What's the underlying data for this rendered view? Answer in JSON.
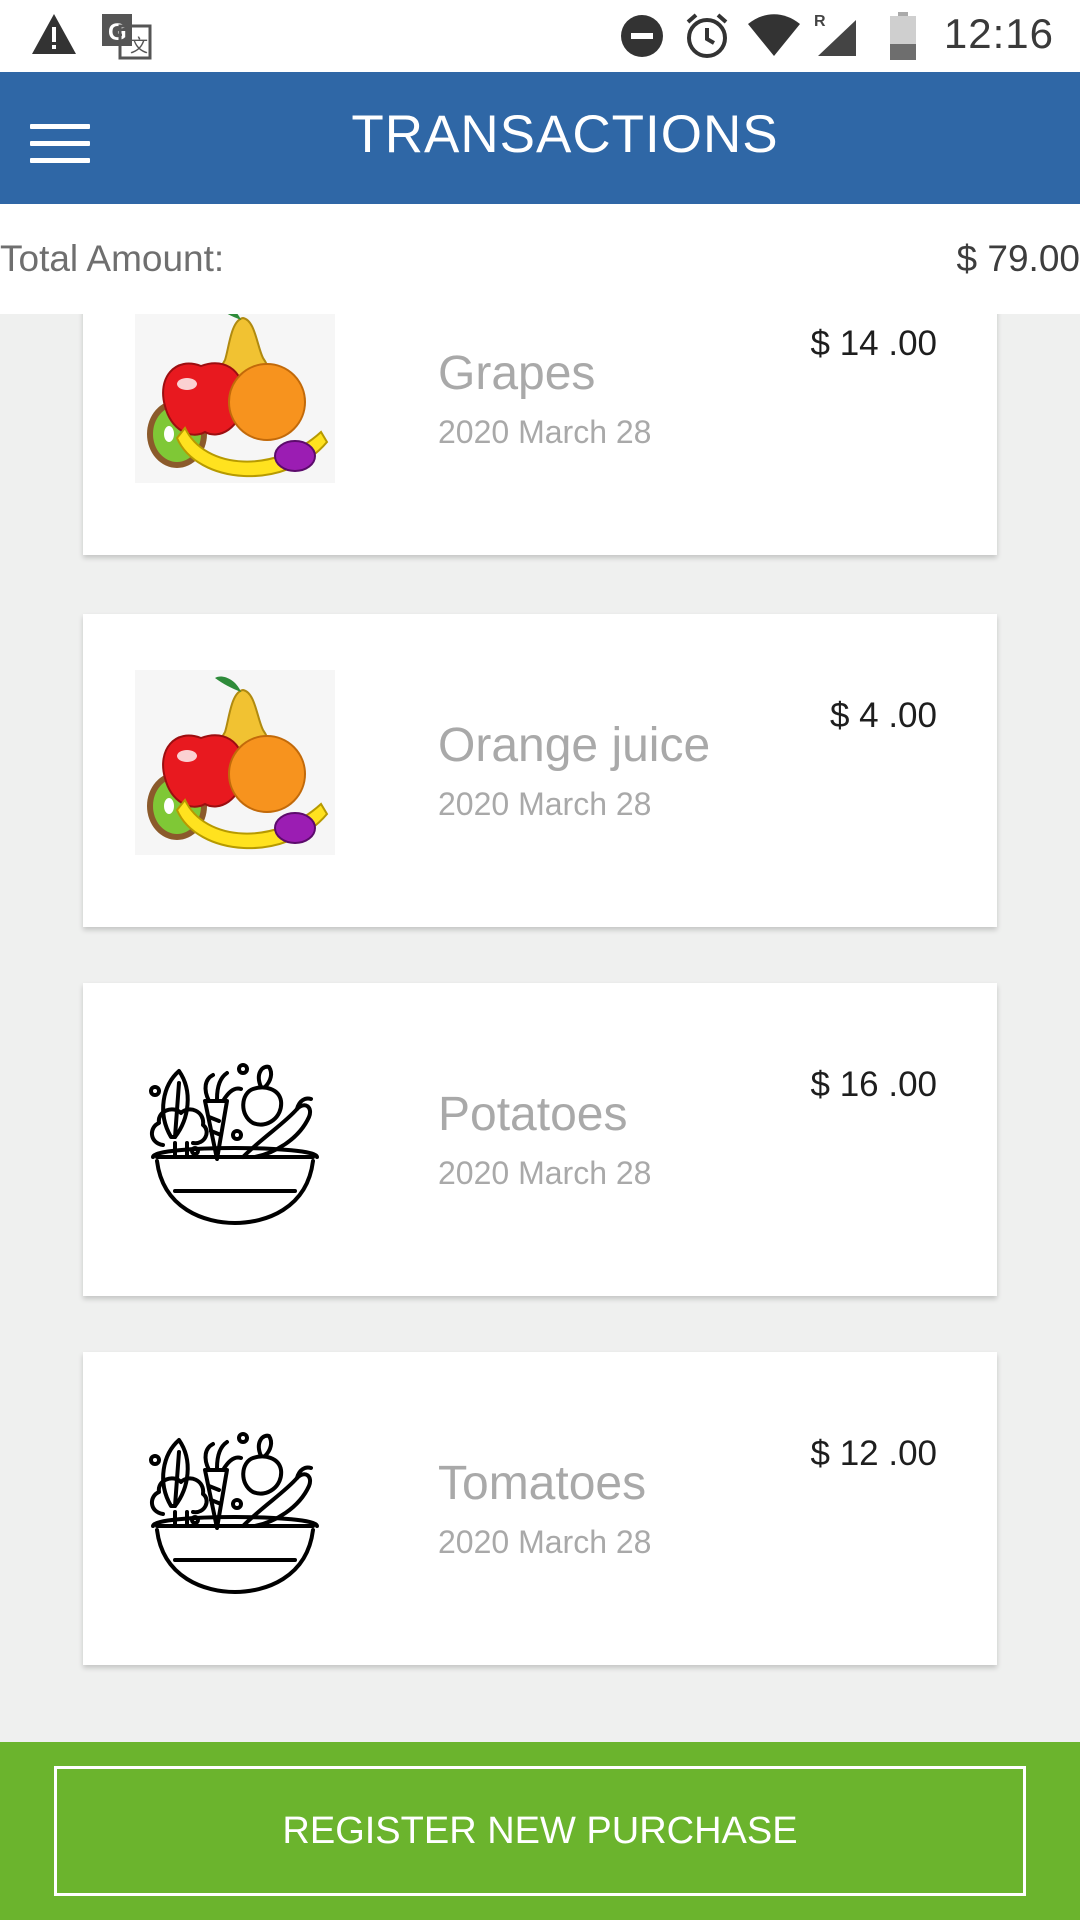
{
  "status_bar": {
    "time": "12:16",
    "icons": [
      "warning-icon",
      "translate-icon",
      "do-not-disturb-icon",
      "alarm-icon",
      "wifi-icon",
      "signal-icon",
      "battery-icon"
    ]
  },
  "header": {
    "title": "TRANSACTIONS",
    "menu_icon": "hamburger-menu-icon",
    "background": "#2f67a6"
  },
  "summary": {
    "label": "Total Amount:",
    "value": "$ 79.00"
  },
  "transactions": [
    {
      "name": "Grapes",
      "date": "2020 March 28",
      "price": "$ 14 .00",
      "icon": "fruit-basket-icon"
    },
    {
      "name": "Orange juice",
      "date": "2020 March 28",
      "price": "$ 4 .00",
      "icon": "fruit-basket-icon"
    },
    {
      "name": "Potatoes",
      "date": "2020 March 28",
      "price": "$ 16 .00",
      "icon": "vegetable-bowl-icon"
    },
    {
      "name": "Tomatoes",
      "date": "2020 March 28",
      "price": "$ 12 .00",
      "icon": "vegetable-bowl-icon"
    }
  ],
  "footer": {
    "button_label": "REGISTER NEW PURCHASE",
    "background": "#6bb42d"
  }
}
